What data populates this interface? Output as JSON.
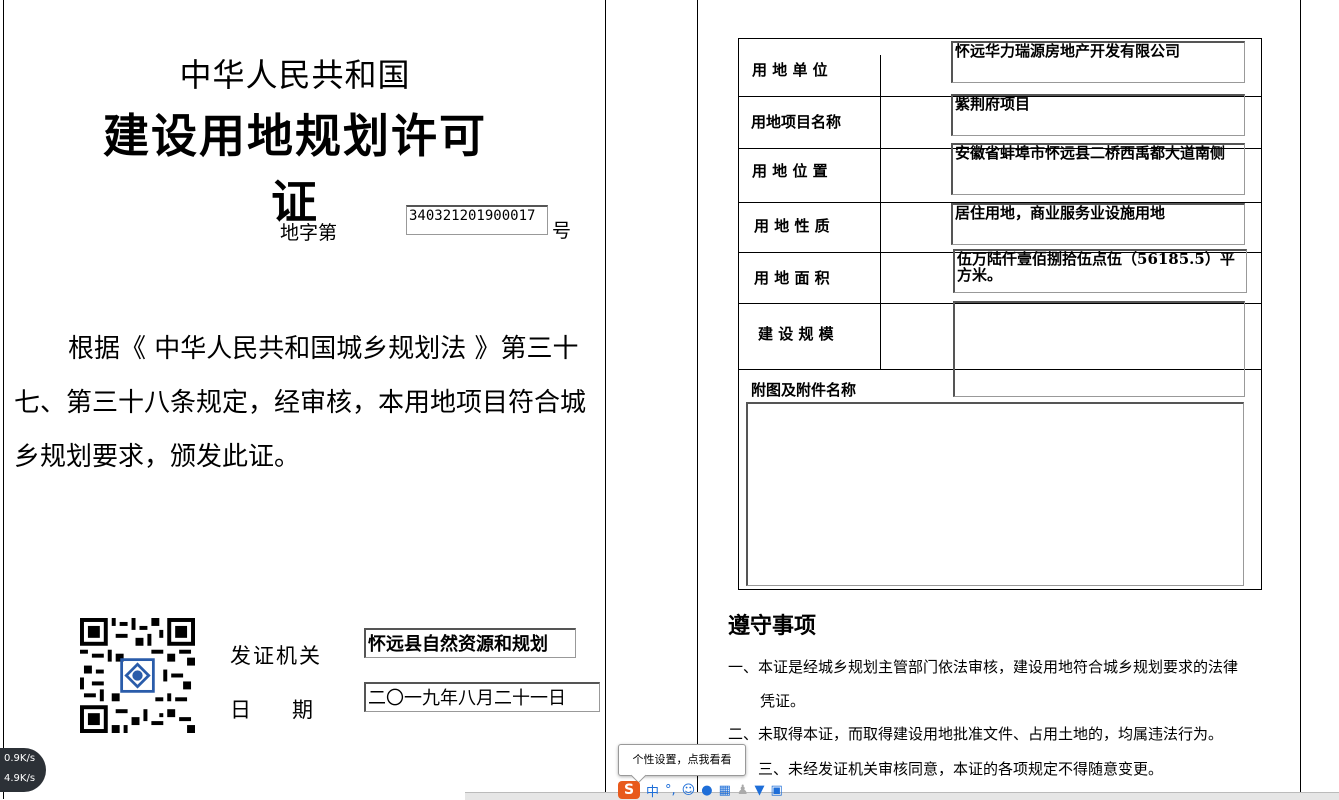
{
  "left_page": {
    "title_line1": "中华人民共和国",
    "title_line2": "建设用地规划许可证",
    "number_prefix": "地字第",
    "number_value": "340321201900017",
    "number_suffix": "号",
    "basis_text": "根据《 中华人民共和国城乡规划法 》第三十七、第三十八条规定，经审核，本用地项目符合城乡规划要求，颁发此证。",
    "issuer_label": "发证机关",
    "issuer_value": "怀远县自然资源和规划",
    "date_label_1": "日",
    "date_label_2": "期",
    "date_value": "二〇一九年八月二十一日"
  },
  "right_page": {
    "rows": [
      {
        "label": "用 地 单 位",
        "value": "怀远华力瑞源房地产开发有限公司"
      },
      {
        "label": "用地项目名称",
        "value": "紫荆府项目"
      },
      {
        "label": "用 地 位 置",
        "value": "安徽省蚌埠市怀远县二桥西禹都大道南侧"
      },
      {
        "label": "用 地 性 质",
        "value": "居住用地，商业服务业设施用地"
      },
      {
        "label": "用 地 面 积",
        "value": "伍万陆仟壹佰捌拾伍点伍（56185.5）平方米。"
      },
      {
        "label": "建 设  规 模",
        "value": ""
      }
    ],
    "attachments_label": "附图及附件名称",
    "attachments_value": "",
    "notes_title": "遵守事项",
    "notes": [
      "一、本证是经城乡规划主管部门依法审核，建设用地符合城乡规划要求的法律",
      "凭证。",
      "二、未取得本证，而取得建设用地批准文件、占用土地的，均属违法行为。",
      "三、未经发证机关审核同意，本证的各项规定不得随意变更。"
    ]
  },
  "overlay": {
    "speed_up": "0.9K/s",
    "speed_down": "4.9K/s",
    "tooltip": "个性设置，点我看看",
    "ime_logo": "S",
    "ime_mode": "中",
    "ime_punct": "°,",
    "ime_icons": [
      "smile-icon",
      "mic-icon",
      "keyboard-icon",
      "user-icon",
      "shirt-icon",
      "grid-icon"
    ]
  }
}
